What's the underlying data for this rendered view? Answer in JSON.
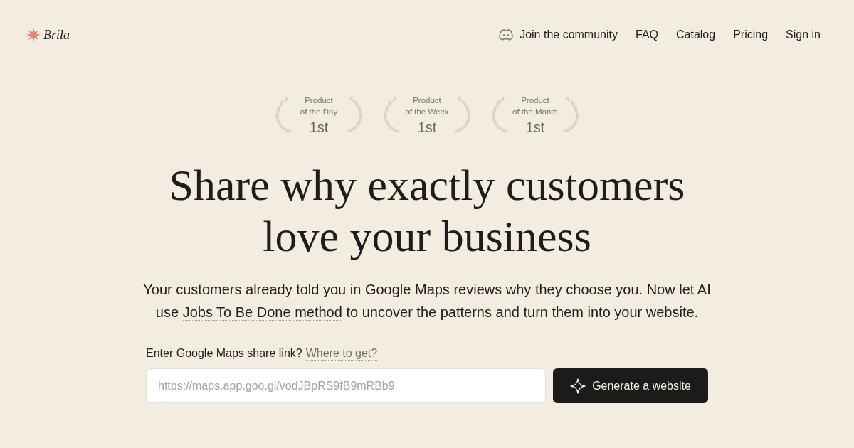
{
  "header": {
    "logo": "Brila",
    "nav": [
      {
        "label": "Join the community",
        "kind": "discord"
      },
      {
        "label": "FAQ",
        "kind": "plain"
      },
      {
        "label": "Catalog",
        "kind": "plain"
      },
      {
        "label": "Pricing",
        "kind": "plain"
      },
      {
        "label": "Sign in",
        "kind": "plain"
      }
    ]
  },
  "awards": [
    {
      "title": "Product",
      "period": "of the Day",
      "rank": "1st"
    },
    {
      "title": "Product",
      "period": "of the Week",
      "rank": "1st"
    },
    {
      "title": "Product",
      "period": "of the Month",
      "rank": "1st"
    }
  ],
  "hero": {
    "headline": "Share why exactly customers love your business",
    "subtitle": {
      "before": "Your customers already told you in Google Maps reviews why they choose you. Now let AI use ",
      "link": "Jobs To Be Done method",
      "after": " to uncover the patterns and turn them into your website."
    }
  },
  "form": {
    "label": "Enter Google Maps share link?",
    "help_link": "Where to get?",
    "placeholder": "https://maps.app.goo.gl/vodJBpRS9fB9mRBb9",
    "button": "Generate a website"
  }
}
